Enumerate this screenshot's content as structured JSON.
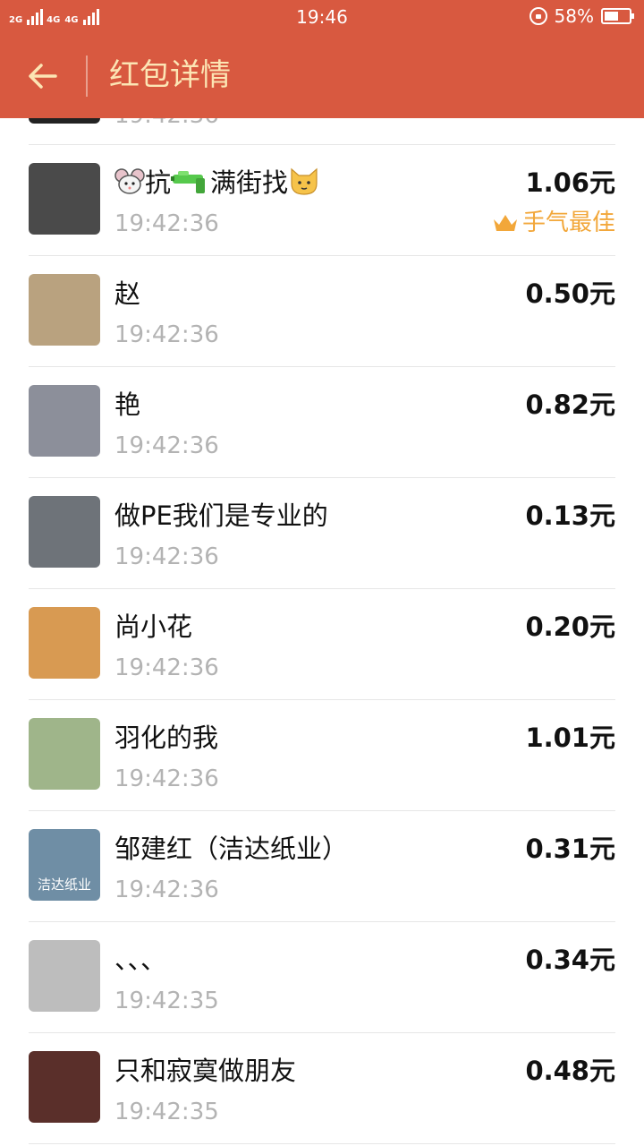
{
  "status_bar": {
    "network_tags": [
      "2G",
      "4G",
      "4G"
    ],
    "time": "19:46",
    "battery": "58%",
    "battery_level": 0.58
  },
  "header": {
    "title": "红包详情"
  },
  "list": {
    "partial_row_time": "19:42:36",
    "rows": [
      {
        "name_parts": [
          "抗",
          "满街找"
        ],
        "time": "19:42:36",
        "amount": "1.06元",
        "badge": "手气最佳",
        "avatar_color": "#4a4a4a"
      },
      {
        "name": "赵",
        "time": "19:42:36",
        "amount": "0.50元",
        "avatar_color": "#b9a27f"
      },
      {
        "name": "艳",
        "time": "19:42:36",
        "amount": "0.82元",
        "avatar_color": "#8c8f9a"
      },
      {
        "name": "做PE我们是专业的",
        "time": "19:42:36",
        "amount": "0.13元",
        "avatar_color": "#6e7379"
      },
      {
        "name": "尚小花",
        "time": "19:42:36",
        "amount": "0.20元",
        "avatar_color": "#d89a52"
      },
      {
        "name": "羽化的我",
        "time": "19:42:36",
        "amount": "1.01元",
        "avatar_color": "#9fb58a"
      },
      {
        "name": "邹建红（洁达纸业）",
        "time": "19:42:36",
        "amount": "0.31元",
        "avatar_color": "#6f8ea5",
        "avatar_text": "洁达纸业"
      },
      {
        "name": "、、、",
        "time": "19:42:35",
        "amount": "0.34元",
        "avatar_color": "#bdbdbd"
      },
      {
        "name": "只和寂寞做朋友",
        "time": "19:42:35",
        "amount": "0.48元",
        "avatar_color": "#5a2f2a"
      }
    ]
  },
  "colors": {
    "header_bg": "#d85940",
    "header_text": "#fce5b4",
    "best_badge": "#f2a73a",
    "time_text": "#b3b3b3"
  },
  "icons": [
    "back-arrow-icon",
    "mouse-emoji-icon",
    "water-gun-emoji-icon",
    "cat-emoji-icon",
    "crown-icon"
  ]
}
